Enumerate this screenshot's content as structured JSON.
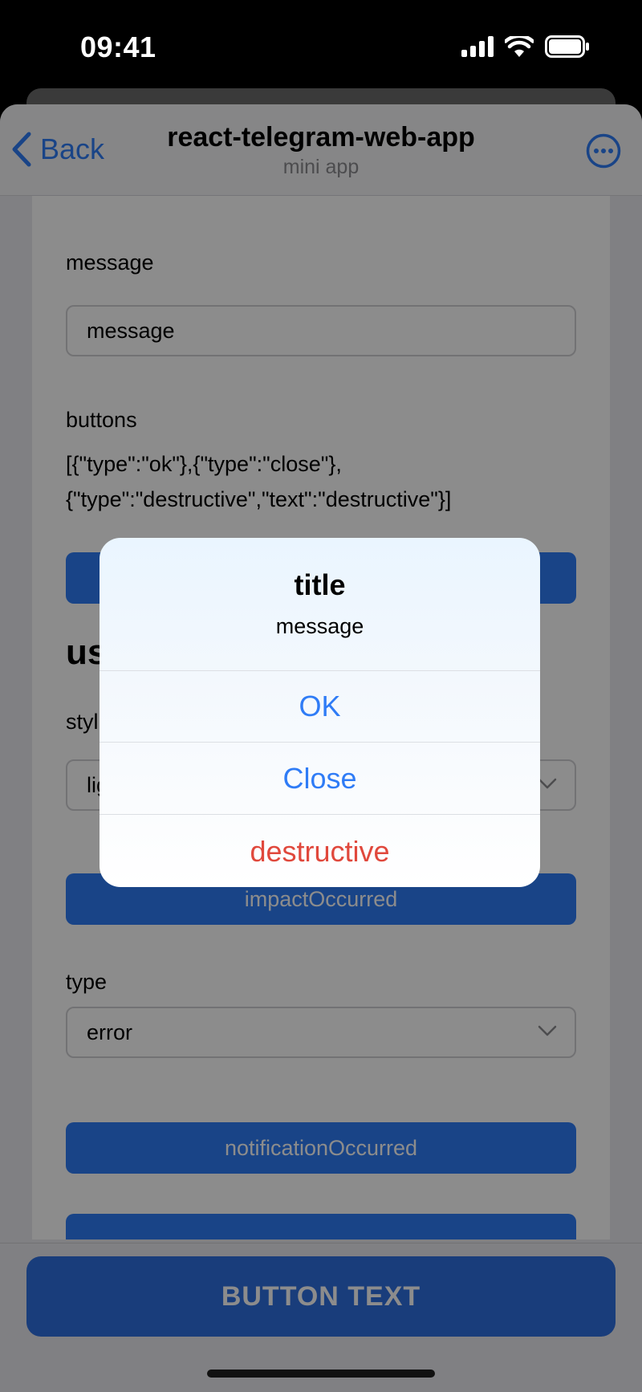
{
  "status_bar": {
    "time": "09:41"
  },
  "nav": {
    "back_label": "Back",
    "title": "react-telegram-web-app",
    "subtitle": "mini app"
  },
  "form": {
    "message_label": "message",
    "message_value": "message",
    "buttons_label": "buttons",
    "buttons_json": "[{\"type\":\"ok\"},{\"type\":\"close\"},\n{\"type\":\"destructive\",\"text\":\"destructive\"}]",
    "haptic_heading": "us",
    "style_label": "styl",
    "style_value": "lig",
    "impact_button": "impactOccurred",
    "type_label": "type",
    "type_value": "error",
    "notification_button": "notificationOccurred"
  },
  "main_button": {
    "label": "BUTTON TEXT"
  },
  "alert": {
    "title": "title",
    "message": "message",
    "actions": [
      {
        "label": "OK",
        "color": "#2f7cf6"
      },
      {
        "label": "Close",
        "color": "#2f7cf6"
      },
      {
        "label": "destructive",
        "color": "#e0483c"
      }
    ]
  },
  "colors": {
    "accent": "#2f7cf6",
    "destructive": "#e0483c"
  }
}
